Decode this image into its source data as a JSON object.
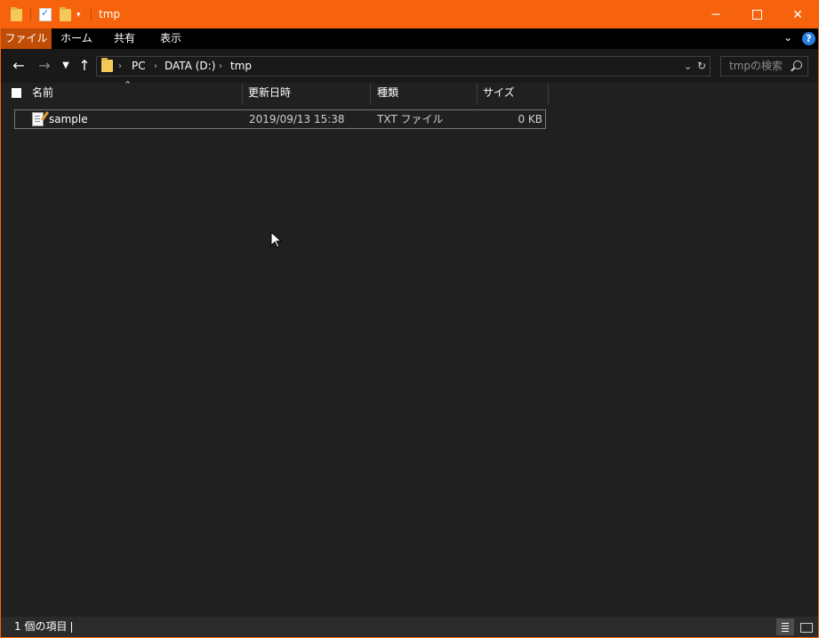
{
  "title": "tmp",
  "ribbon_tabs": [
    "ファイル",
    "ホーム",
    "共有",
    "表示"
  ],
  "breadcrumbs": [
    "PC",
    "DATA (D:)",
    "tmp"
  ],
  "search_placeholder": "tmpの検索",
  "columns": [
    "名前",
    "更新日時",
    "種類",
    "サイズ"
  ],
  "files": [
    {
      "name": "sample",
      "modified": "2019/09/13 15:38",
      "type": "TXT ファイル",
      "size": "0 KB",
      "icon": "text-file-icon"
    }
  ],
  "status": {
    "items_text": "1 個の項目"
  },
  "icons": {
    "back": "arrow-left-icon",
    "forward": "arrow-right-icon",
    "recent": "chevron-down-icon",
    "up": "arrow-up-icon",
    "refresh": "refresh-icon",
    "search": "search-icon",
    "help": "help-icon"
  },
  "colors": {
    "accent": "#f7630c",
    "file_tab": "#c04d05",
    "background": "#202020"
  }
}
